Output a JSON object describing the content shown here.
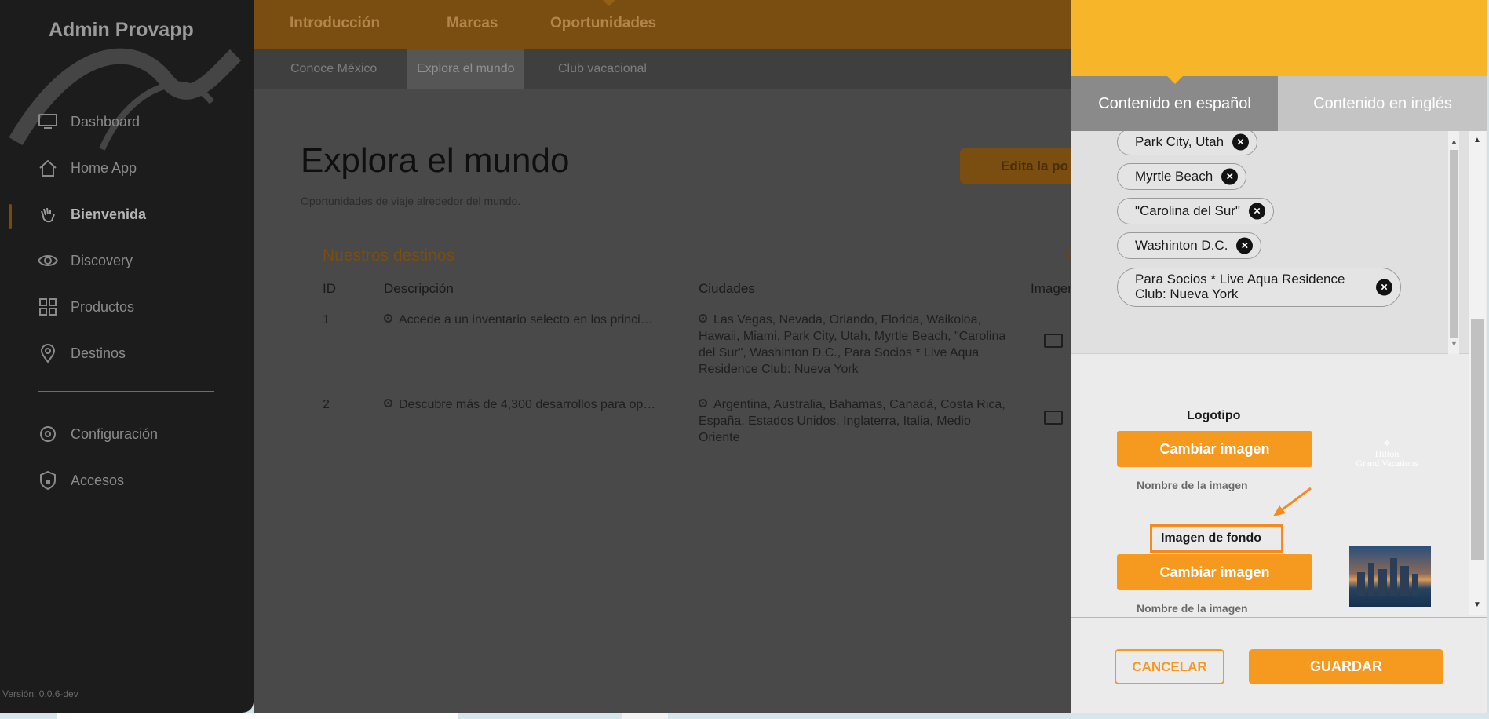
{
  "sidebar": {
    "brand": "Admin Provapp",
    "items": [
      {
        "label": "Dashboard",
        "icon": "monitor-icon"
      },
      {
        "label": "Home App",
        "icon": "home-icon"
      },
      {
        "label": "Bienvenida",
        "icon": "wave-hand-icon",
        "active": true
      },
      {
        "label": "Discovery",
        "icon": "eye-icon"
      },
      {
        "label": "Productos",
        "icon": "grid-icon"
      },
      {
        "label": "Destinos",
        "icon": "location-pin-icon"
      },
      {
        "label": "Configuración",
        "icon": "gear-icon"
      },
      {
        "label": "Accesos",
        "icon": "shield-lock-icon"
      }
    ],
    "version": "Versión: 0.0.6-dev"
  },
  "topbar": {
    "tabs": [
      "Introducción",
      "Marcas",
      "Oportunidades"
    ],
    "active_tab": "Oportunidades"
  },
  "subbar": {
    "tabs": [
      "Conoce México",
      "Explora el mundo",
      "Club vacacional"
    ],
    "active_tab": "Explora el mundo"
  },
  "main": {
    "title": "Explora el mundo",
    "subtitle": "Oportunidades de viaje alrededor del mundo.",
    "edit_button": "Edita la po",
    "section_title": "Nuestros destinos",
    "table": {
      "headers": [
        "ID",
        "Descripción",
        "Ciudades",
        "Imagen"
      ],
      "rows": [
        {
          "id": "1",
          "descripcion": "Accede a un inventario selecto en los princi…",
          "ciudades": "Las Vegas, Nevada, Orlando, Florida, Waikoloa, Hawaii, Miami, Park City, Utah, Myrtle Beach, \"Carolina del Sur\", Washinton D.C., Para Socios * Live Aqua Residence Club: Nueva York"
        },
        {
          "id": "2",
          "descripcion": "Descubre más de 4,300 desarrollos para op…",
          "ciudades": "Argentina, Australia, Bahamas, Canadá, Costa Rica, España, Estados Unidos, Inglaterra, Italia, Medio Oriente"
        }
      ]
    }
  },
  "panel": {
    "tabs": {
      "es": "Contenido en español",
      "en": "Contenido en inglés"
    },
    "tags": [
      "Park City, Utah",
      "Myrtle Beach",
      "\"Carolina del Sur\"",
      "Washinton D.C.",
      "Para Socios * Live Aqua Residence Club: Nueva York"
    ],
    "logo_label": "Logotipo",
    "change_image_label": "Cambiar imagen",
    "image_name_label": "Nombre de la imagen",
    "background_label": "Imagen de fondo",
    "logo_text": "Hilton Grand Vacations",
    "cancel_label": "CANCELAR",
    "save_label": "GUARDAR"
  },
  "colors": {
    "accent": "#f69a1f",
    "header_yellow": "#f7b52a",
    "sidebar_bg": "#1c1c1c",
    "overlay_main": "#494949"
  }
}
